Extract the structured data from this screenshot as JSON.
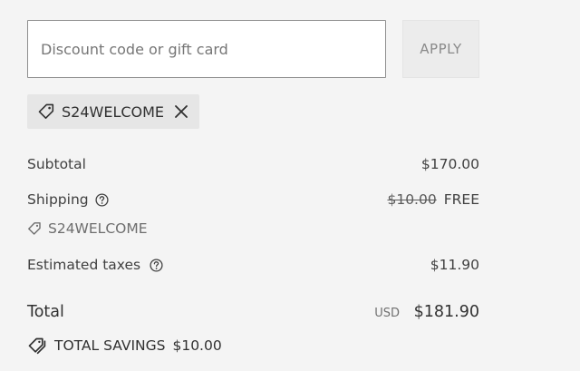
{
  "discount": {
    "placeholder": "Discount code or gift card",
    "apply_label": "APPLY",
    "applied_code": "S24WELCOME"
  },
  "summary": {
    "subtotal_label": "Subtotal",
    "subtotal_value": "$170.00",
    "shipping_label": "Shipping",
    "shipping_original": "$10.00",
    "shipping_value": "FREE",
    "shipping_code": "S24WELCOME",
    "taxes_label": "Estimated taxes",
    "taxes_value": "$11.90"
  },
  "total": {
    "label": "Total",
    "currency": "USD",
    "amount": "$181.90"
  },
  "savings": {
    "label": "TOTAL SAVINGS",
    "amount": "$10.00"
  },
  "icons": {
    "chip_tag": "tag-icon",
    "chip_remove": "close-icon",
    "help": "question-circle-icon",
    "savings": "tags-icon"
  }
}
